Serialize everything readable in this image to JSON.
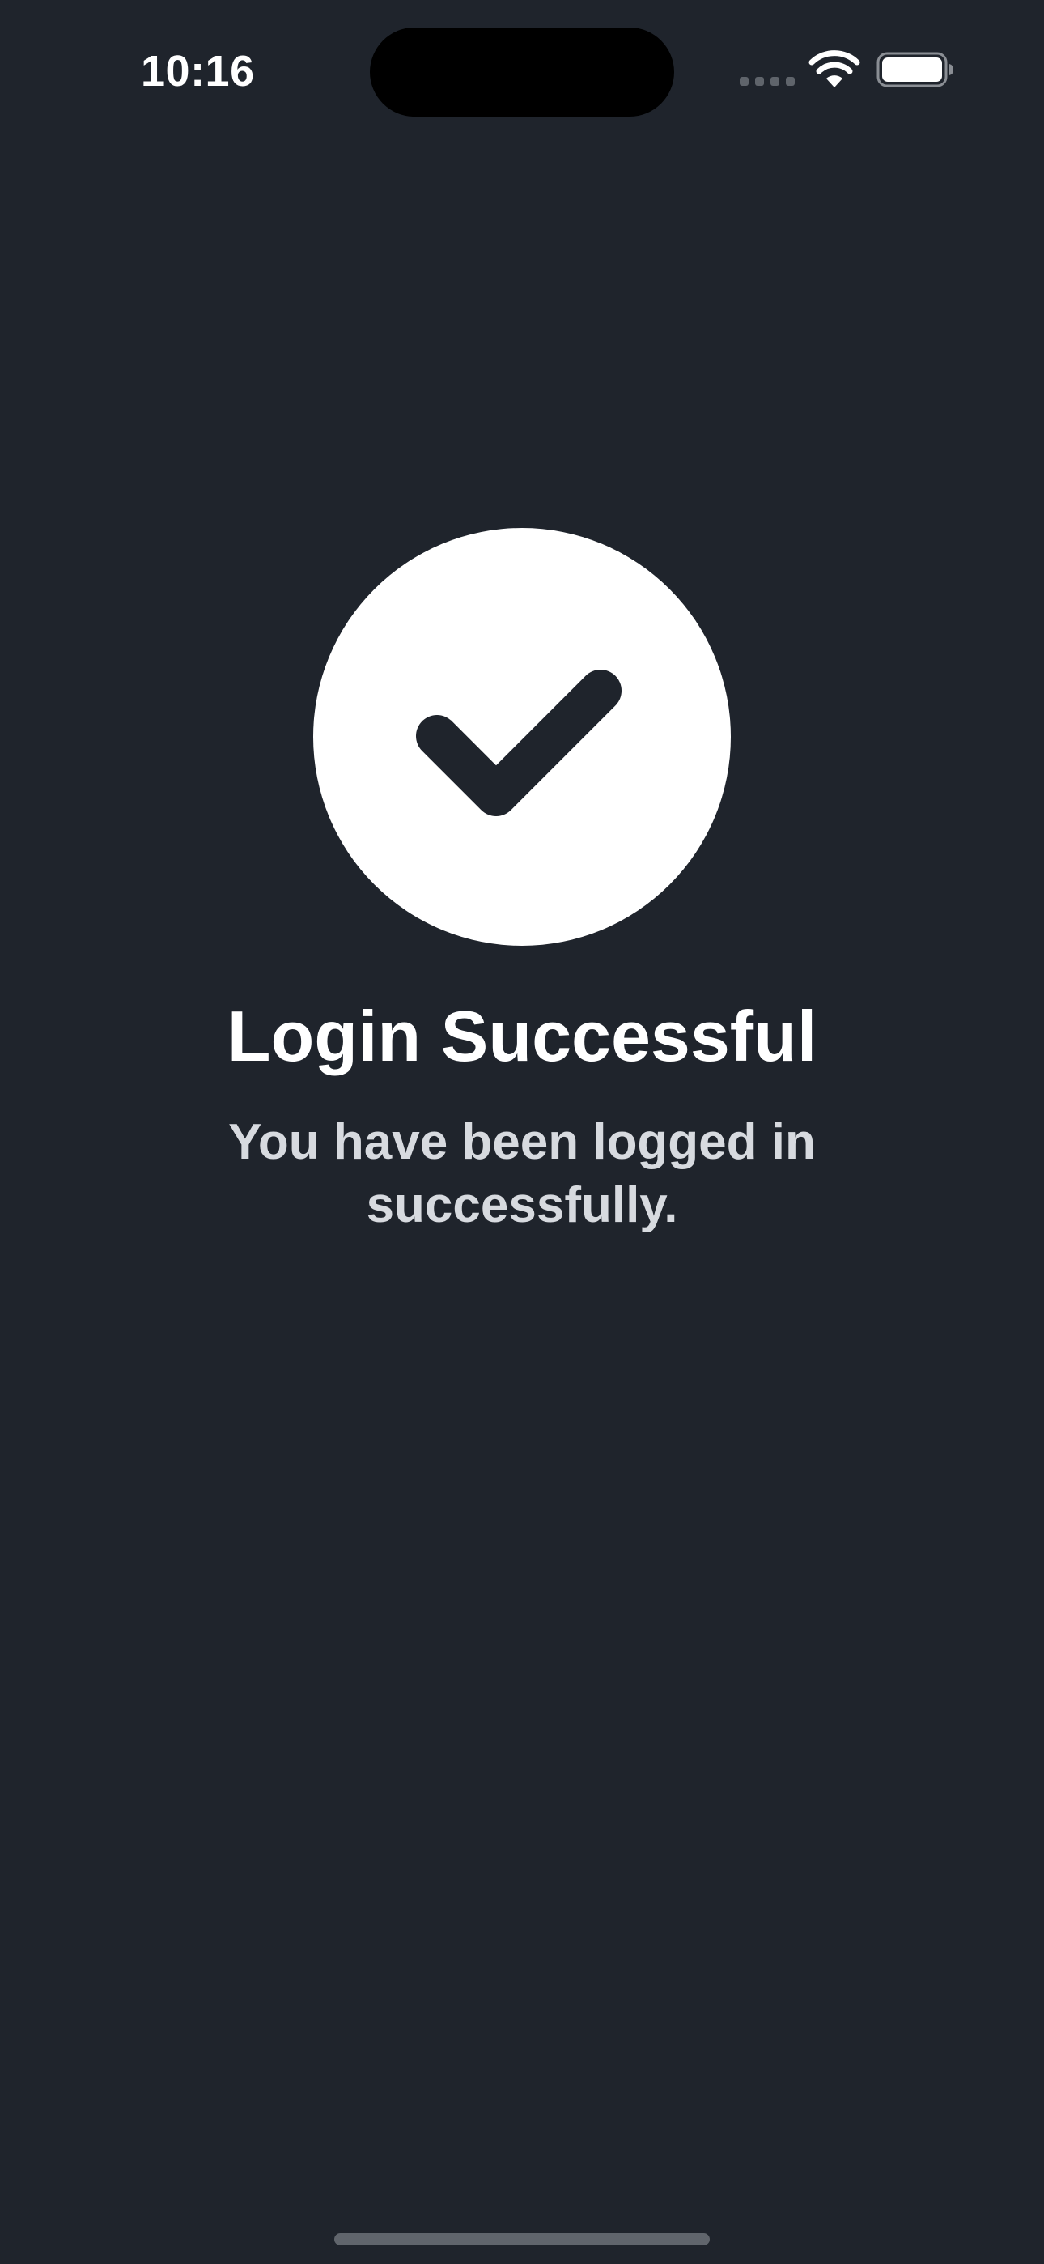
{
  "status_bar": {
    "time": "10:16",
    "icons": [
      "cellular-signal-icon",
      "wifi-icon",
      "battery-icon"
    ]
  },
  "success": {
    "icon": "checkmark-circle-icon",
    "title": "Login Successful",
    "message": "You have been logged in successfully."
  },
  "colors": {
    "background": "#1f242c",
    "icon_circle": "#ffffff",
    "checkmark": "#1f242c",
    "title_text": "#ffffff",
    "message_text": "#d7dadf"
  }
}
